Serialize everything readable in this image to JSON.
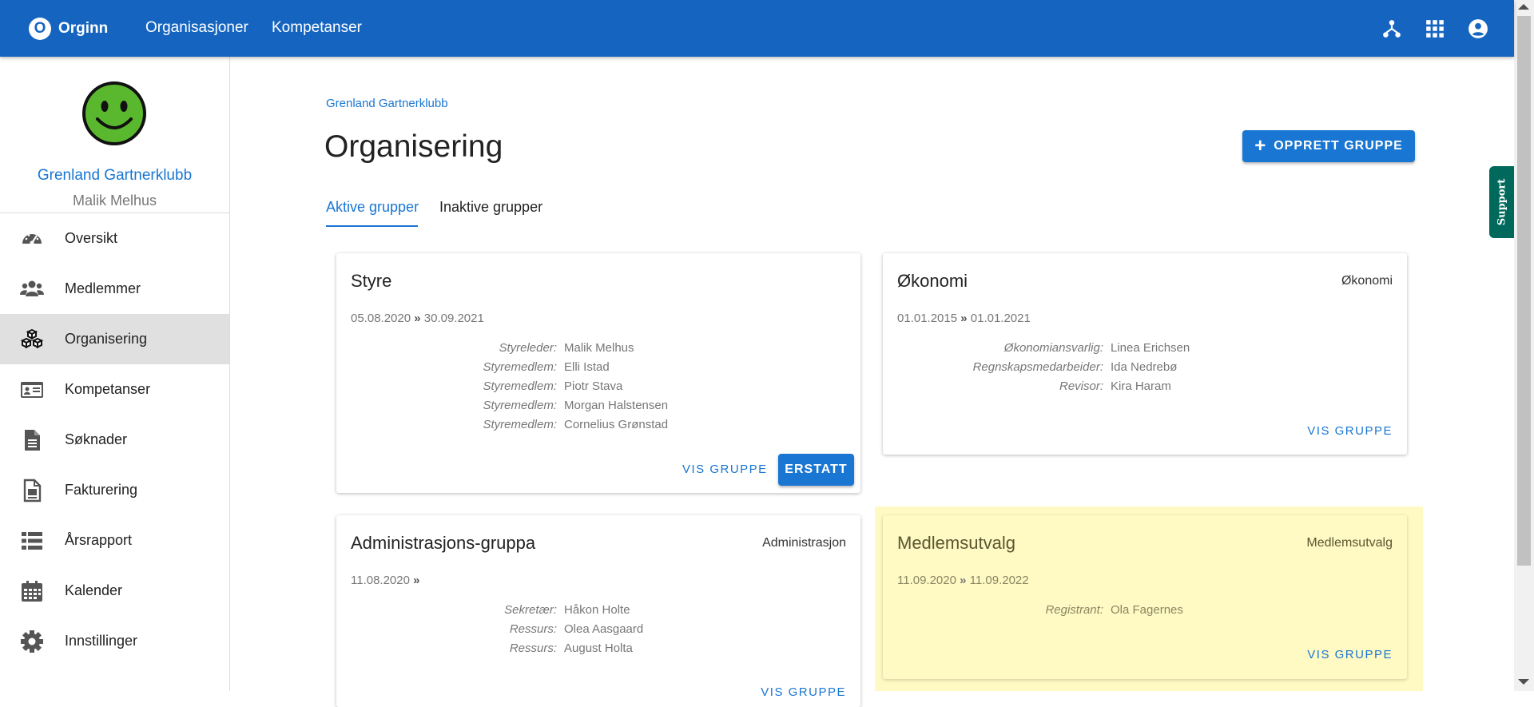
{
  "app": {
    "logo_letter": "O",
    "name": "Orginn"
  },
  "topnav": [
    {
      "label": "Organisasjoner"
    },
    {
      "label": "Kompetanser"
    }
  ],
  "top_icons": [
    "network-icon",
    "apps-grid-icon",
    "account-circle-icon"
  ],
  "sidebar": {
    "org_name": "Grenland Gartnerklubb",
    "user_name": "Malik Melhus",
    "items": [
      {
        "label": "Oversikt",
        "icon": "speedometer-icon",
        "active": false
      },
      {
        "label": "Medlemmer",
        "icon": "people-icon",
        "active": false
      },
      {
        "label": "Organisering",
        "icon": "cubes-icon",
        "active": true
      },
      {
        "label": "Kompetanser",
        "icon": "id-card-icon",
        "active": false
      },
      {
        "label": "Søknader",
        "icon": "document-icon",
        "active": false
      },
      {
        "label": "Fakturering",
        "icon": "invoice-icon",
        "active": false
      },
      {
        "label": "Årsrapport",
        "icon": "list-icon",
        "active": false
      },
      {
        "label": "Kalender",
        "icon": "calendar-icon",
        "active": false
      },
      {
        "label": "Innstillinger",
        "icon": "gear-icon",
        "active": false
      }
    ]
  },
  "breadcrumb": "Grenland Gartnerklubb",
  "page_title": "Organisering",
  "create_button": {
    "icon": "+",
    "label": "OPPRETT GRUPPE"
  },
  "tabs": [
    {
      "label": "Aktive grupper",
      "active": true
    },
    {
      "label": "Inaktive grupper",
      "active": false
    }
  ],
  "support_label": "Support",
  "groups": [
    {
      "title": "Styre",
      "type": "",
      "start": "05.08.2020",
      "end": "30.09.2021",
      "roles": [
        {
          "label": "Styreleder:",
          "name": "Malik Melhus"
        },
        {
          "label": "Styremedlem:",
          "name": "Elli Istad"
        },
        {
          "label": "Styremedlem:",
          "name": "Piotr Stava"
        },
        {
          "label": "Styremedlem:",
          "name": "Morgan Halstensen"
        },
        {
          "label": "Styremedlem:",
          "name": "Cornelius Grønstad"
        }
      ],
      "view_label": "VIS GRUPPE",
      "replace_label": "ERSTATT"
    },
    {
      "title": "Økonomi",
      "type": "Økonomi",
      "start": "01.01.2015",
      "end": "01.01.2021",
      "roles": [
        {
          "label": "Økonomiansvarlig:",
          "name": "Linea Erichsen"
        },
        {
          "label": "Regnskapsmedarbeider:",
          "name": "Ida Nedrebø"
        },
        {
          "label": "Revisor:",
          "name": "Kira Haram"
        }
      ],
      "view_label": "VIS GRUPPE"
    },
    {
      "title": "Administrasjons-gruppa",
      "type": "Administrasjon",
      "start": "11.08.2020",
      "end": "",
      "roles": [
        {
          "label": "Sekretær:",
          "name": "Håkon Holte"
        },
        {
          "label": "Ressurs:",
          "name": "Olea Aasgaard"
        },
        {
          "label": "Ressurs:",
          "name": "August Holta"
        }
      ],
      "view_label": "VIS GRUPPE"
    },
    {
      "title": "Medlemsutvalg",
      "type": "Medlemsutvalg",
      "start": "11.09.2020",
      "end": "11.09.2022",
      "roles": [
        {
          "label": "Registrant:",
          "name": "Ola Fagernes"
        }
      ],
      "view_label": "VIS GRUPPE"
    }
  ],
  "colors": {
    "primary": "#1565c0",
    "accent": "#1976d2",
    "highlight": "#fff9c4",
    "support": "#00695c"
  }
}
